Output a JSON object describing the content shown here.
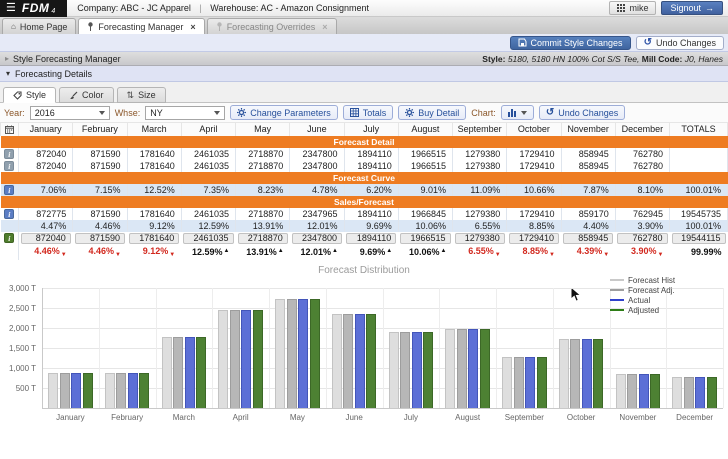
{
  "topbar": {
    "logo": "FDM",
    "logo_sub": "4",
    "company_label": "Company:",
    "company_value": "ABC - JC Apparel",
    "divider": "|",
    "warehouse_label": "Warehouse:",
    "warehouse_value": "AC - Amazon Consignment",
    "user": "mike",
    "signout_label": "Signout"
  },
  "tab_bar": {
    "tabs": [
      {
        "label": "Home Page"
      },
      {
        "label": "Forecasting Manager"
      },
      {
        "label": "Forecasting Overrides"
      }
    ],
    "close_glyph": "×"
  },
  "action_bar": {
    "commit_label": "Commit Style Changes",
    "undo_label": "Undo Changes"
  },
  "section_header": {
    "title": "Style Forecasting Manager",
    "style_label": "Style:",
    "style_value": "5180, 5180 HN 100% Cot S/S Tee,",
    "mill_label": "Mill Code:",
    "mill_value": "J0, Hanes"
  },
  "details_header": {
    "title": "Forecasting Details"
  },
  "view_tabs": {
    "tabs": [
      {
        "label": "Style"
      },
      {
        "label": "Color"
      },
      {
        "label": "Size"
      }
    ]
  },
  "controls": {
    "year_label": "Year:",
    "year_value": "2016",
    "whse_label": "Whse:",
    "whse_value": "NY",
    "change_parameters_label": "Change Parameters",
    "totals_label": "Totals",
    "buy_detail_label": "Buy Detail",
    "chart_label": "Chart:",
    "undo_label": "Undo Changes"
  },
  "table": {
    "months": [
      "January",
      "February",
      "March",
      "April",
      "May",
      "June",
      "July",
      "August",
      "September",
      "October",
      "November",
      "December"
    ],
    "totals_label": "TOTALS",
    "rows": [
      {
        "kind": "section",
        "label": "Forecast Detail"
      },
      {
        "kind": "values",
        "icon": "info-gray",
        "values": [
          "872040",
          "871590",
          "1781640",
          "2461035",
          "2718870",
          "2347800",
          "1894110",
          "1966515",
          "1279380",
          "1729410",
          "858945",
          "762780"
        ],
        "total": ""
      },
      {
        "kind": "values",
        "icon": "info-gray",
        "values": [
          "872040",
          "871590",
          "1781640",
          "2461035",
          "2718870",
          "2347800",
          "1894110",
          "1966515",
          "1279380",
          "1729410",
          "858945",
          "762780"
        ],
        "total": ""
      },
      {
        "kind": "section",
        "label": "Forecast Curve"
      },
      {
        "kind": "values",
        "icon": "info-blue",
        "shaded": true,
        "values": [
          "7.06%",
          "7.15%",
          "12.52%",
          "7.35%",
          "8.23%",
          "4.78%",
          "6.20%",
          "9.01%",
          "11.09%",
          "10.66%",
          "7.87%",
          "8.10%"
        ],
        "total": "100.01%"
      },
      {
        "kind": "section",
        "label": "Sales/Forecast"
      },
      {
        "kind": "values",
        "icon": "info-blue",
        "values": [
          "872775",
          "871590",
          "1781640",
          "2461035",
          "2718870",
          "2347965",
          "1894110",
          "1966845",
          "1279380",
          "1729410",
          "859170",
          "762945"
        ],
        "total": "19545735"
      },
      {
        "kind": "values",
        "shaded": true,
        "values": [
          "4.47%",
          "4.46%",
          "9.12%",
          "12.59%",
          "13.91%",
          "12.01%",
          "9.69%",
          "10.06%",
          "6.55%",
          "8.85%",
          "4.40%",
          "3.90%"
        ],
        "total": "100.01%"
      },
      {
        "kind": "inputs",
        "icon": "info-green",
        "values": [
          "872040",
          "871590",
          "1781640",
          "2461035",
          "2718870",
          "2347800",
          "1894110",
          "1966515",
          "1279380",
          "1729410",
          "858945",
          "762780"
        ],
        "total": "19544115"
      },
      {
        "kind": "deltas",
        "values": [
          {
            "text": "4.46%",
            "dir": "down"
          },
          {
            "text": "4.46%",
            "dir": "down"
          },
          {
            "text": "9.12%",
            "dir": "down"
          },
          {
            "text": "12.59%",
            "dir": "up"
          },
          {
            "text": "13.91%",
            "dir": "up"
          },
          {
            "text": "12.01%",
            "dir": "up"
          },
          {
            "text": "9.69%",
            "dir": "up"
          },
          {
            "text": "10.06%",
            "dir": "up"
          },
          {
            "text": "6.55%",
            "dir": "down"
          },
          {
            "text": "8.85%",
            "dir": "down"
          },
          {
            "text": "4.39%",
            "dir": "down"
          },
          {
            "text": "3.90%",
            "dir": "down"
          }
        ],
        "total": "99.99%"
      }
    ]
  },
  "chart_data": {
    "type": "bar",
    "title": "Forecast Distribution",
    "categories": [
      "January",
      "February",
      "March",
      "April",
      "May",
      "June",
      "July",
      "August",
      "September",
      "October",
      "November",
      "December"
    ],
    "unit": "T (thousands of units)",
    "ylim": [
      0,
      3000
    ],
    "yticks": [
      500,
      1000,
      1500,
      2000,
      2500,
      3000
    ],
    "ytick_labels": [
      "500 T",
      "1,000 T",
      "1,500 T",
      "2,000 T",
      "2,500 T",
      "3,000 T"
    ],
    "grid": true,
    "legend_position": "top-right",
    "series": [
      {
        "name": "Forecast Hist",
        "color": "#dedede",
        "border": "#c3c3c3",
        "legend_color": "#c9c9c9",
        "values": [
          872,
          872,
          1782,
          2461,
          2719,
          2348,
          1894,
          1967,
          1279,
          1729,
          859,
          763
        ]
      },
      {
        "name": "Forecast Adj.",
        "color": "#b7b7b7",
        "border": "#9d9d9d",
        "legend_color": "#9e9e9e",
        "values": [
          872,
          872,
          1782,
          2461,
          2719,
          2348,
          1894,
          1967,
          1279,
          1729,
          859,
          763
        ]
      },
      {
        "name": "Actual",
        "color": "#5c6fd6",
        "border": "#4355b9",
        "legend_color": "#3142cc",
        "values": [
          873,
          872,
          1782,
          2461,
          2719,
          2348,
          1894,
          1967,
          1279,
          1729,
          859,
          763
        ]
      },
      {
        "name": "Adjusted",
        "color": "#4d8133",
        "border": "#3c6827",
        "legend_color": "#2e7d17",
        "values": [
          872,
          872,
          1782,
          2461,
          2719,
          2348,
          1894,
          1967,
          1279,
          1729,
          859,
          763
        ]
      }
    ]
  },
  "colors": {
    "accent_orange": "#ee7c22",
    "accent_blue": "#4576b3",
    "shaded_row": "#dbe7f5",
    "delta_red": "#d2281e"
  }
}
